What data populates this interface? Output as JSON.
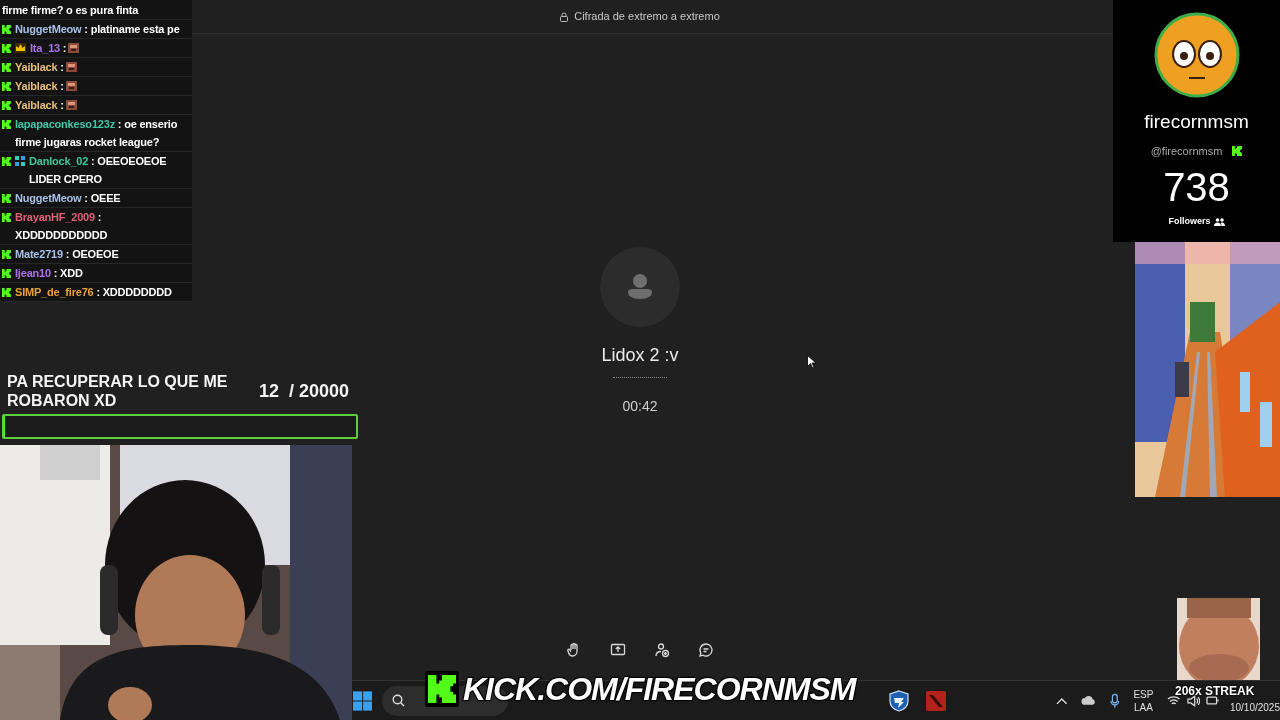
{
  "call": {
    "encryption_notice": "Cifrada de extremo a extremo",
    "contact_name": "Lidox 2 :v",
    "duration": "00:42",
    "toolbar": [
      {
        "kind": "hand"
      },
      {
        "kind": "share"
      },
      {
        "kind": "add-person"
      },
      {
        "kind": "chat"
      }
    ]
  },
  "chat": [
    {
      "text": "firme firme? o es pura finta",
      "kick_badge": false,
      "crown_badge": false,
      "gift_badge": false,
      "emote": false
    },
    {
      "user": "NuggetMeow",
      "color": "#a9c0e8",
      "separator": ":",
      "text": "platiname esta pe",
      "kick_badge": true,
      "crown_badge": false,
      "gift_badge": false,
      "emote": false
    },
    {
      "user": "Ita_13",
      "color": "#a974e8",
      "separator": ":",
      "kick_badge": true,
      "crown_badge": true,
      "gift_badge": false,
      "emote": true
    },
    {
      "user": "Yaiblack",
      "color": "#e8c07a",
      "separator": ":",
      "kick_badge": true,
      "crown_badge": false,
      "gift_badge": false,
      "emote": true
    },
    {
      "user": "Yaiblack",
      "color": "#e8c07a",
      "separator": ":",
      "kick_badge": true,
      "crown_badge": false,
      "gift_badge": false,
      "emote": true
    },
    {
      "user": "Yaiblack",
      "color": "#e8c07a",
      "separator": ":",
      "kick_badge": true,
      "crown_badge": false,
      "gift_badge": false,
      "emote": true
    },
    {
      "user": "lapapaconkeso123z",
      "color": "#3fc9a8",
      "separator": ":",
      "text": "oe enserio firme jugaras rocket league?",
      "kick_badge": true,
      "crown_badge": false,
      "gift_badge": false,
      "emote": false
    },
    {
      "user": "Danlock_02",
      "color": "#3fc99a",
      "separator": ":",
      "text": "OEEOEOEOE LIDER CPERO",
      "kick_badge": true,
      "crown_badge": false,
      "gift_badge": true,
      "emote": false
    },
    {
      "user": "NuggetMeow",
      "color": "#a9c0e8",
      "separator": ":",
      "text": "OEEE",
      "kick_badge": true,
      "crown_badge": false,
      "gift_badge": false,
      "emote": false
    },
    {
      "user": "BrayanHF_2009",
      "color": "#e0607a",
      "separator": ":",
      "text": "XDDDDDDDDDDD",
      "kick_badge": true,
      "crown_badge": false,
      "gift_badge": false,
      "emote": false
    },
    {
      "user": "Mate2719",
      "color": "#a9c0e8",
      "separator": ":",
      "text": "OEOEOE",
      "kick_badge": true,
      "crown_badge": false,
      "gift_badge": false,
      "emote": false
    },
    {
      "user": "Ijean10",
      "color": "#a974e8",
      "separator": ":",
      "text": "XDD",
      "kick_badge": true,
      "crown_badge": false,
      "gift_badge": false,
      "emote": false
    },
    {
      "user": "SIMP_de_fire76",
      "color": "#e8a23a",
      "separator": ":",
      "text": "XDDDDDDDD",
      "kick_badge": true,
      "crown_badge": false,
      "gift_badge": false,
      "emote": false
    }
  ],
  "goal": {
    "title": "PA RECUPERAR LO QUE ME ROBARON XD",
    "current": "12",
    "target": "/ 20000",
    "level": 0.0006
  },
  "profile": {
    "name": "firecornmsm",
    "handle": "@firecornmsm",
    "count": "738",
    "label": "Followers"
  },
  "banner": {
    "text": "KICK.COM/FIRECORNMSM"
  },
  "streak": {
    "text": "206x STREAK"
  },
  "taskbar": {
    "apps": [
      {
        "kind": "rocket"
      },
      {
        "kind": "dota"
      }
    ],
    "language": "ESP",
    "layout": "LAA",
    "date": "10/10/2025"
  }
}
